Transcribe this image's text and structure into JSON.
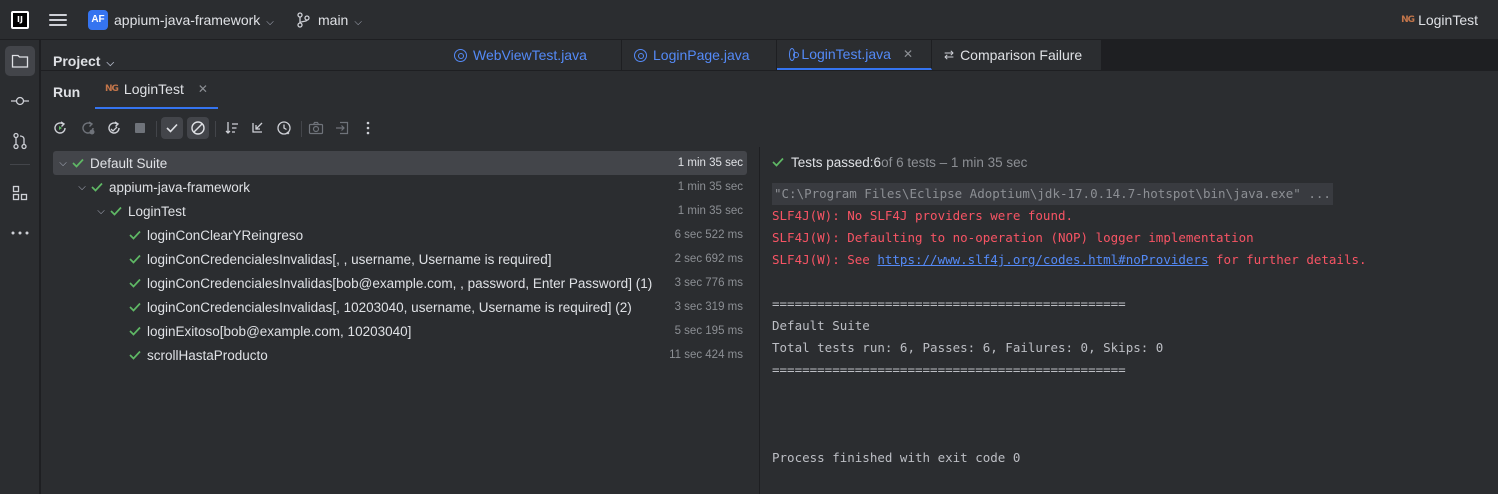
{
  "titlebar": {
    "logo_text": "IJ",
    "project_badge": "AF",
    "project_name": "appium-java-framework",
    "branch": "main",
    "run_config": "LoginTest",
    "run_config_icon": "NG"
  },
  "project_panel": {
    "title": "Project"
  },
  "editor_tabs": [
    {
      "label": "WebViewTest.java"
    },
    {
      "label": "LoginPage.java"
    },
    {
      "label": "LoginTest.java"
    },
    {
      "label": "Comparison Failure"
    }
  ],
  "run_window": {
    "title": "Run",
    "tab_label": "LoginTest",
    "tab_icon": "NG"
  },
  "test_tree": [
    {
      "name": "Default Suite",
      "duration": "1 min 35 sec"
    },
    {
      "name": "appium-java-framework",
      "duration": "1 min 35 sec"
    },
    {
      "name": "LoginTest",
      "duration": "1 min 35 sec"
    },
    {
      "name": "loginConClearYReingreso",
      "duration": "6 sec 522 ms"
    },
    {
      "name": "loginConCredencialesInvalidas[, , username, Username is required]",
      "duration": "2 sec 692 ms"
    },
    {
      "name": "loginConCredencialesInvalidas[bob@example.com, , password, Enter Password] (1)",
      "duration": "3 sec 776 ms"
    },
    {
      "name": "loginConCredencialesInvalidas[, 10203040, username, Username is required] (2)",
      "duration": "3 sec 319 ms"
    },
    {
      "name": "loginExitoso[bob@example.com, 10203040]",
      "duration": "5 sec 195 ms"
    },
    {
      "name": "scrollHastaProducto",
      "duration": "11 sec 424 ms"
    }
  ],
  "console_status": {
    "prefix": "Tests passed: ",
    "passed": "6",
    "rest": " of 6 tests – 1 min 35 sec"
  },
  "console": {
    "cmd": "\"C:\\Program Files\\Eclipse Adoptium\\jdk-17.0.14.7-hotspot\\bin\\java.exe\" ...",
    "err1": "SLF4J(W): No SLF4J providers were found.",
    "err2": "SLF4J(W): Defaulting to no-operation (NOP) logger implementation",
    "err3_pre": "SLF4J(W): See ",
    "err3_link": "https://www.slf4j.org/codes.html#noProviders",
    "err3_post": " for further details.",
    "sep1": "===============================================",
    "suite": "Default Suite",
    "totals": "Total tests run: 6, Passes: 6, Failures: 0, Skips: 0",
    "sep2": "===============================================",
    "exit": "Process finished with exit code 0"
  },
  "colors": {
    "accent": "#3574f0",
    "pass_green": "#5fb865",
    "error_red": "#f75464",
    "link_blue": "#548af7"
  }
}
